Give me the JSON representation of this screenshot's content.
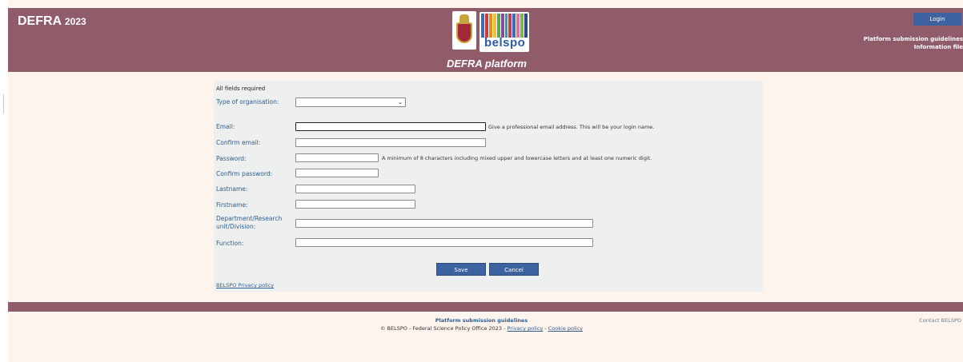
{
  "header": {
    "brand": "DEFRA",
    "year": "2023",
    "platform_title": "DEFRA platform",
    "logo_text": "belspo",
    "login_label": "Login",
    "links": [
      "Platform submission guidelines",
      "Information file"
    ]
  },
  "form": {
    "note": "All fields required",
    "type_label": "Type of organisation:",
    "type_value": "",
    "email_label": "Email:",
    "email_hint": "Give a professional email address. This will be your login name.",
    "confirm_email_label": "Confirm email:",
    "password_label": "Password:",
    "password_hint": "A minimum of 8 characters including mixed upper and lowercase letters and at least one numeric digit.",
    "confirm_password_label": "Confirm password:",
    "lastname_label": "Lastname:",
    "firstname_label": "Firstname:",
    "department_label": "Department/Research unit/Division:",
    "function_label": "Function:",
    "save_label": "Save",
    "cancel_label": "Cancel",
    "privacy_label": "BELSPO Privacy policy"
  },
  "footer": {
    "guidelines_label": "Platform submission guidelines",
    "copyright": "© BELSPO - Federal Science Policy Office 2023 -",
    "privacy_label": "Privacy policy",
    "separator": "-",
    "cookie_label": "Cookie policy",
    "contact_label": "Contact BELSPO"
  },
  "colors": {
    "header_bg": "#905c6a",
    "page_bg": "#fef4ee",
    "panel_bg": "#eef0f0",
    "button_bg": "#3c63a0",
    "label_color": "#2f5c8c"
  }
}
